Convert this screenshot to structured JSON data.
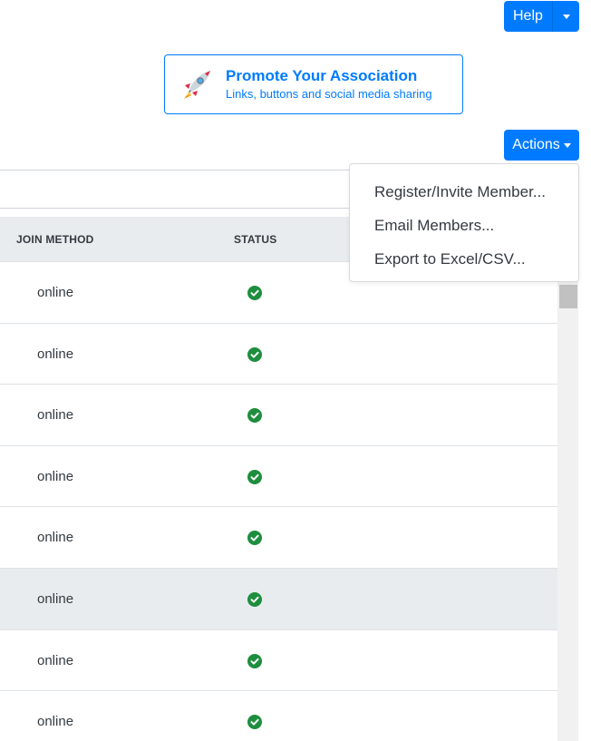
{
  "header": {
    "help_label": "Help",
    "actions_label": "Actions"
  },
  "promote": {
    "title": "Promote Your Association",
    "subtitle": "Links, buttons and social media sharing"
  },
  "table": {
    "columns": [
      "JOIN METHOD",
      "STATUS"
    ],
    "rows": [
      {
        "join_method": "online",
        "status": "active"
      },
      {
        "join_method": "online",
        "status": "active"
      },
      {
        "join_method": "online",
        "status": "active"
      },
      {
        "join_method": "online",
        "status": "active"
      },
      {
        "join_method": "online",
        "status": "active"
      },
      {
        "join_method": "online",
        "status": "active"
      },
      {
        "join_method": "online",
        "status": "active"
      },
      {
        "join_method": "online",
        "status": "active"
      }
    ]
  },
  "actions_menu": {
    "items": [
      "Register/Invite Member...",
      "Email Members...",
      "Export to Excel/CSV..."
    ]
  },
  "colors": {
    "primary": "#007bff",
    "success": "#1e8e3e",
    "header_bg": "#e9ecef"
  },
  "icons": {
    "status": "check-circle-icon",
    "promote": "rocket-icon"
  }
}
